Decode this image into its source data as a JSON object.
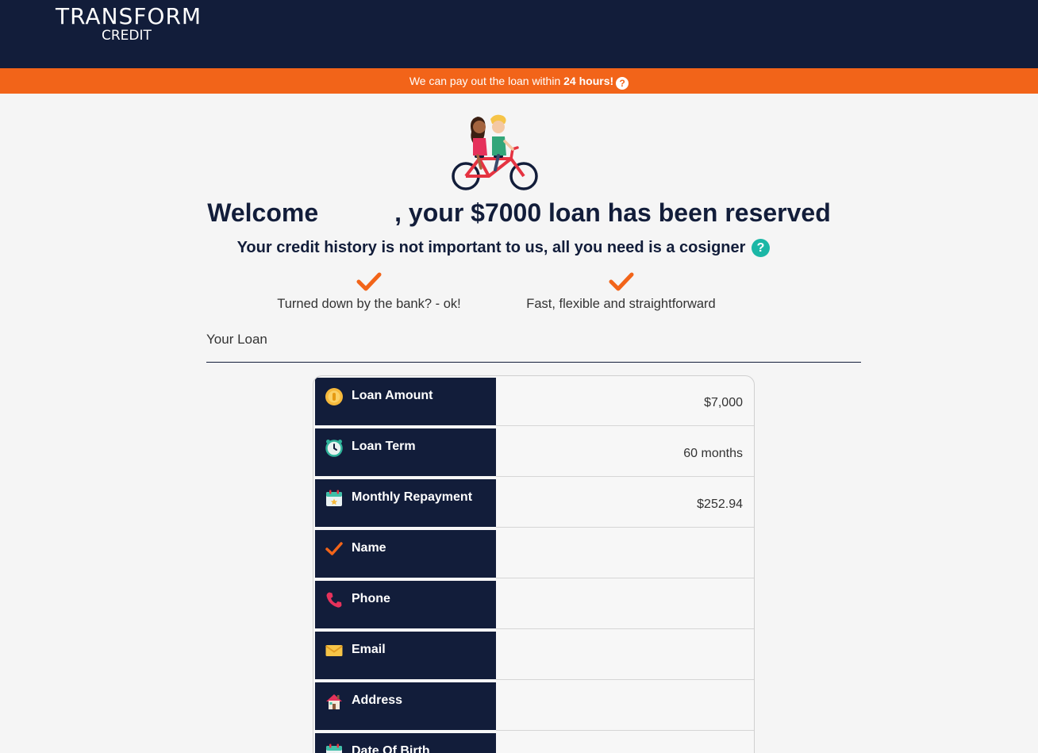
{
  "brand": {
    "name_main": "TRANSFORM",
    "name_sub": "CREDIT"
  },
  "promo": {
    "text_before": "We can pay out the loan within ",
    "text_bold": "24 hours!",
    "help_symbol": "?"
  },
  "welcome": {
    "greeting": "Welcome",
    "headline": ", your $7000 loan has been reserved"
  },
  "subtitle": {
    "text": "Your credit history is not important to us, all you need is a cosigner",
    "help_symbol": "?"
  },
  "features": [
    {
      "icon": "check-icon",
      "text": "Turned down by the bank? - ok!"
    },
    {
      "icon": "check-icon",
      "text": "Fast, flexible and straightforward"
    }
  ],
  "loan_section": {
    "title": "Your Loan"
  },
  "loan_rows": [
    {
      "icon": "coin-icon",
      "label": "Loan Amount",
      "value": "$7,000"
    },
    {
      "icon": "alarm-clock-icon",
      "label": "Loan Term",
      "value": "60 months"
    },
    {
      "icon": "calendar-icon",
      "label": "Monthly Repayment",
      "value": "$252.94"
    },
    {
      "icon": "check-icon",
      "label": "Name",
      "value": ""
    },
    {
      "icon": "phone-icon",
      "label": "Phone",
      "value": ""
    },
    {
      "icon": "envelope-icon",
      "label": "Email",
      "value": ""
    },
    {
      "icon": "house-icon",
      "label": "Address",
      "value": ""
    },
    {
      "icon": "calendar-icon",
      "label": "Date Of Birth",
      "value": ""
    }
  ],
  "colors": {
    "navy": "#121d3a",
    "orange": "#f26419",
    "teal": "#1bb7a6"
  }
}
